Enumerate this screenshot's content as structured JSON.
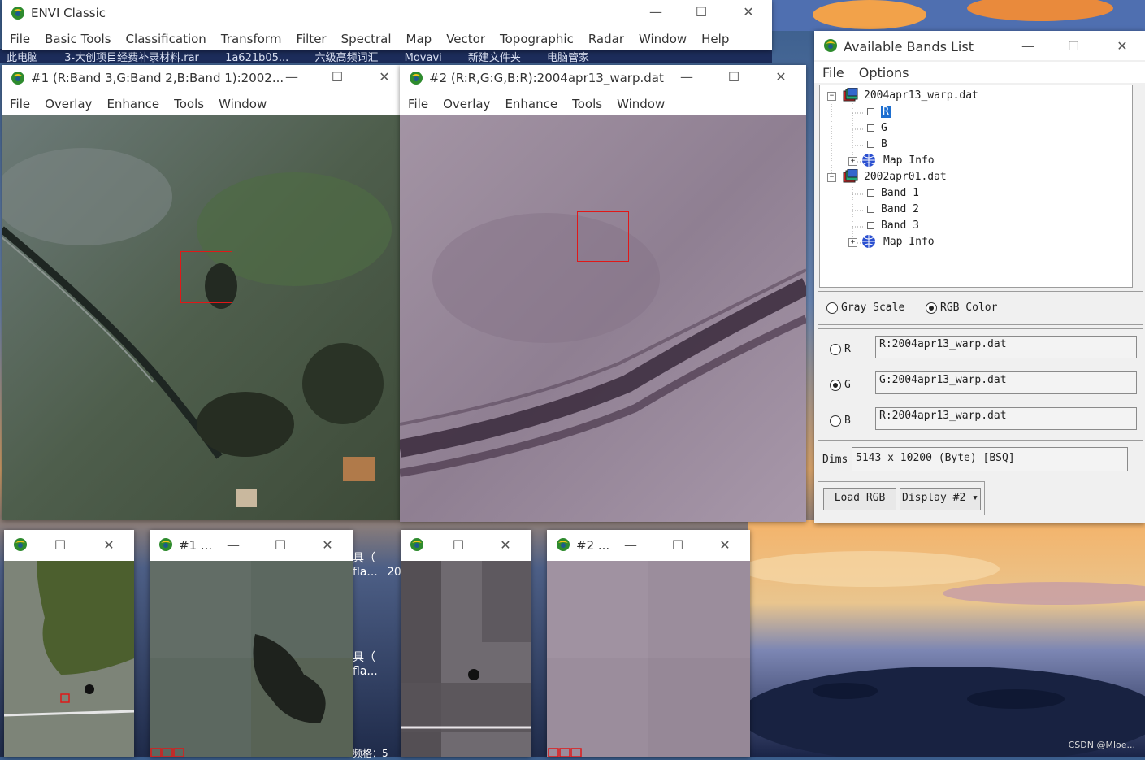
{
  "desktop": {
    "taskbar_items": [
      "此电脑",
      "3-大创项目经费补录材料.rar",
      "1a621b05...",
      "六级高频词汇",
      "Movavi",
      "新建文件夹",
      "电脑管家"
    ],
    "scattered_labels": [
      "具（",
      "fla...",
      "20",
      "具（",
      "fla...",
      "频格：5"
    ],
    "watermark": "CSDN @Mloe..."
  },
  "envi_main": {
    "title": "ENVI Classic",
    "menu": [
      "File",
      "Basic Tools",
      "Classification",
      "Transform",
      "Filter",
      "Spectral",
      "Map",
      "Vector",
      "Topographic",
      "Radar",
      "Window",
      "Help"
    ]
  },
  "display1": {
    "title": "#1 (R:Band 3,G:Band 2,B:Band 1):2002...",
    "menu": [
      "File",
      "Overlay",
      "Enhance",
      "Tools",
      "Window"
    ]
  },
  "display2": {
    "title": "#2 (R:R,G:G,B:R):2004apr13_warp.dat",
    "menu": [
      "File",
      "Overlay",
      "Enhance",
      "Tools",
      "Window"
    ]
  },
  "small_windows": {
    "scroll1_title": "",
    "zoom1_title": "#1 ...",
    "scroll2_title": "",
    "zoom2_title": "#2 ..."
  },
  "window_controls": {
    "minimize": "—",
    "maximize": "☐",
    "close": "✕"
  },
  "bands_list": {
    "title": "Available Bands List",
    "menu": [
      "File",
      "Options"
    ],
    "tree": [
      {
        "label": "2004apr13_warp.dat",
        "children": [
          "R",
          "G",
          "B",
          "Map Info"
        ]
      },
      {
        "label": "2002apr01.dat",
        "children": [
          "Band 1",
          "Band 2",
          "Band 3",
          "Map Info"
        ]
      }
    ],
    "selected_band": "R",
    "mode_gray": "Gray Scale",
    "mode_rgb": "RGB Color",
    "channels": [
      {
        "label": "R",
        "value": "R:2004apr13_warp.dat",
        "selected": false
      },
      {
        "label": "G",
        "value": "G:2004apr13_warp.dat",
        "selected": true
      },
      {
        "label": "B",
        "value": "R:2004apr13_warp.dat",
        "selected": false
      }
    ],
    "dims_label": "Dims",
    "dims_value": "5143 x 10200 (Byte) [BSQ]",
    "load_button": "Load RGB",
    "display_button": "Display #2"
  }
}
